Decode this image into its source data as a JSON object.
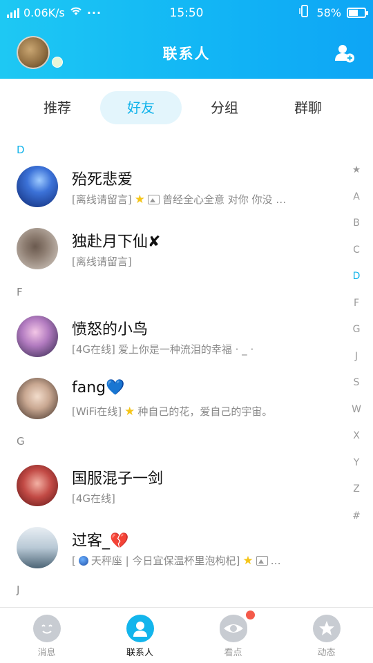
{
  "statusbar": {
    "speed": "0.06K/s",
    "dots": "···",
    "time": "15:50",
    "battery_pct": "58%",
    "battery_level": 0.58
  },
  "header": {
    "title": "联系人",
    "add_icon": "add-contact-icon"
  },
  "tabs": [
    {
      "label": "推荐",
      "active": false
    },
    {
      "label": "好友",
      "active": true
    },
    {
      "label": "分组",
      "active": false
    },
    {
      "label": "群聊",
      "active": false
    }
  ],
  "sections": [
    "D",
    "F",
    "G",
    "J"
  ],
  "contacts": [
    {
      "name": "殆死悲爱",
      "status_tag": "[离线请留言]",
      "star": true,
      "pic": true,
      "message": "曾经全心全意 对你 你没 …",
      "avatar_color": "#1b3f9e"
    },
    {
      "name": "独赴月下仙✘",
      "status_tag": "[离线请留言]",
      "star": false,
      "pic": false,
      "message": "",
      "avatar_color": "#b6a79a"
    },
    {
      "name": "愤怒的小鸟",
      "status_tag": "[4G在线]",
      "star": false,
      "pic": false,
      "message": "爱上你是一种流泪的幸福 · _ ·",
      "avatar_color": "#9a6fa8"
    },
    {
      "name": "fang💙",
      "status_tag": "[WiFi在线]",
      "star": true,
      "pic": false,
      "message": "种自己的花，爱自己的宇宙。",
      "avatar_color": "#d8c4b4"
    },
    {
      "name": "国服混子一剑",
      "status_tag": "[4G在线]",
      "star": false,
      "pic": false,
      "message": "",
      "avatar_color": "#a93a3a"
    },
    {
      "name": "过客_💔",
      "status_tag": "[",
      "status_tag2": "天秤座 | 今日宜保温杯里泡枸杞]",
      "star": true,
      "pic": true,
      "message": "…",
      "avatar_color": "#9bb1c2"
    }
  ],
  "index_bar": [
    "★",
    "A",
    "B",
    "C",
    "D",
    "F",
    "G",
    "J",
    "S",
    "W",
    "X",
    "Y",
    "Z",
    "#"
  ],
  "index_active": "D",
  "bottom_nav": [
    {
      "label": "消息",
      "icon": "message-icon",
      "active": false
    },
    {
      "label": "联系人",
      "icon": "contacts-icon",
      "active": true
    },
    {
      "label": "看点",
      "icon": "eye-icon",
      "active": false,
      "badge": true
    },
    {
      "label": "动态",
      "icon": "star-planet-icon",
      "active": false
    }
  ],
  "colors": {
    "accent": "#12b3ea",
    "header_start": "#1ec8f3",
    "header_end": "#0ea5f5",
    "badge_red": "#f45a4a"
  }
}
